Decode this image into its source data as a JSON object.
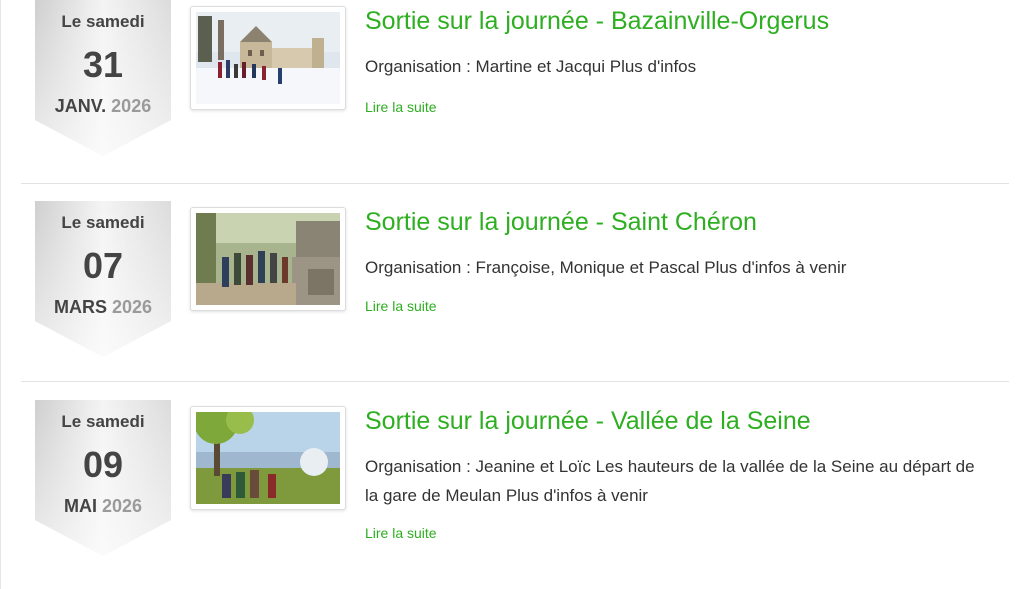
{
  "events": [
    {
      "weekday": "Le samedi",
      "day": "31",
      "month": "JANV.",
      "year": "2026",
      "title": "Sortie sur la journée - Bazainville-Orgerus",
      "description": "Organisation : Martine et Jacqui   Plus d'infos",
      "read_more": "Lire la suite",
      "thumbnail": "hikers-in-snow-near-chateau"
    },
    {
      "weekday": "Le samedi",
      "day": "07",
      "month": "MARS",
      "year": "2026",
      "title": "Sortie sur la journée - Saint Chéron",
      "description": "Organisation : Françoise, Monique et Pascal Plus d'infos à venir",
      "read_more": "Lire la suite",
      "thumbnail": "hikers-on-rocky-forest-path"
    },
    {
      "weekday": "Le samedi",
      "day": "09",
      "month": "MAI",
      "year": "2026",
      "title": "Sortie sur la journée - Vallée de la Seine",
      "description": "Organisation : Jeanine et Loïc Les hauteurs de la vallée de la Seine au départ de la gare de Meulan Plus d'infos à venir",
      "read_more": "Lire la suite",
      "thumbnail": "hikers-overlooking-seine-valley"
    }
  ],
  "colors": {
    "accent_green": "#2eae21",
    "date_text": "#444444",
    "year_text": "#9a9a9a"
  }
}
